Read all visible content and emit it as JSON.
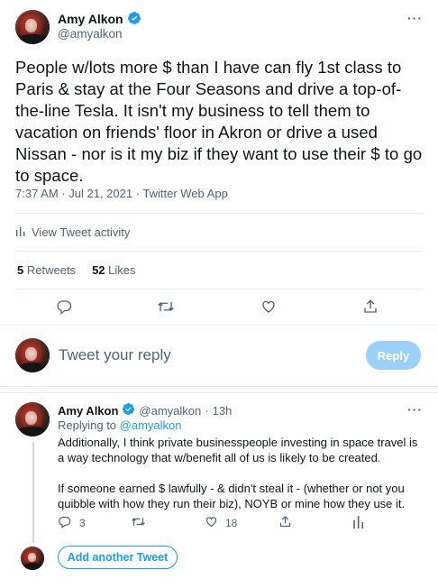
{
  "tweet": {
    "author_name": "Amy Alkon",
    "author_handle": "@amyalkon",
    "text": "People w/lots more $ than I have can fly 1st class to Paris & stay at the Four Seasons and drive a top-of-the-line Tesla. It isn't my business to tell them to vacation on friends' floor in Akron or drive a used Nissan - nor is it my biz if they want to use their $ to go to space.",
    "meta": "7:37 AM · Jul 21, 2021 · Twitter Web App",
    "activity_label": "View Tweet activity",
    "retweets_count": "5",
    "retweets_label": "Retweets",
    "likes_count": "52",
    "likes_label": "Likes"
  },
  "composer": {
    "placeholder": "Tweet your reply",
    "reply_button": "Reply"
  },
  "reply": {
    "author_name": "Amy Alkon",
    "author_handle": "@amyalkon",
    "separator": "·",
    "time": "13h",
    "replying_prefix": "Replying to",
    "replying_to": "@amyalkon",
    "paragraph1": "Additionally, I think private businesspeople investing in space travel is a way technology that w/benefit all of us is likely to be created.",
    "paragraph2": "If someone earned $ lawfully - & didn't steal it - (whether or not you quibble with how they run their biz), NOYB or mine how they use it.",
    "reply_count": "3",
    "like_count": "18"
  },
  "thread": {
    "add_button": "Add another Tweet"
  },
  "colors": {
    "accent": "#1d9bf0",
    "reply_button_disabled": "#9bd1f9",
    "secondary_text": "#536471"
  },
  "icons": [
    "verified-badge-icon",
    "more-icon",
    "bar-chart-icon",
    "reply-icon",
    "retweet-icon",
    "like-icon",
    "share-icon",
    "analytics-icon"
  ]
}
